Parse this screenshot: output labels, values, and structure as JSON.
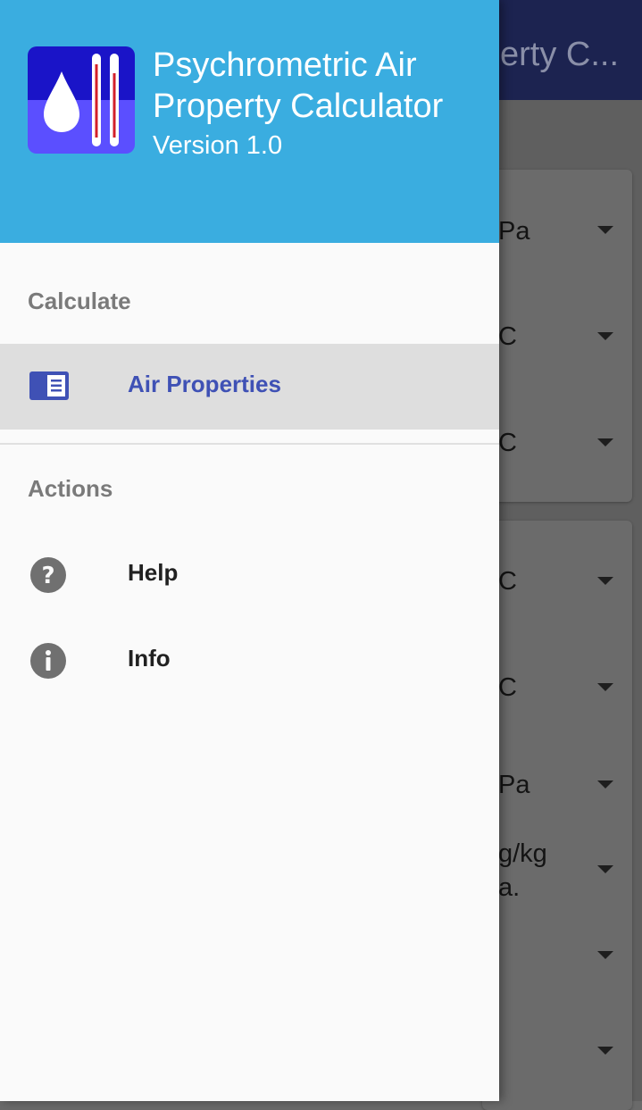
{
  "background": {
    "app_title_partial": "erty C...",
    "rows_card1": [
      "Pa",
      "C",
      "C"
    ],
    "rows_card2": [
      "C",
      "C",
      "Pa",
      "g/kg\na.",
      "",
      ""
    ]
  },
  "drawer": {
    "header": {
      "app_name": "Psychrometric Air Property Calculator",
      "version": "Version 1.0",
      "icon": "droplet-thermometer-icon",
      "color": "#3aade0"
    },
    "sections": [
      {
        "label": "Calculate",
        "items": [
          {
            "label": "Air Properties",
            "icon": "list-panel-icon",
            "active": true
          }
        ]
      },
      {
        "label": "Actions",
        "items": [
          {
            "label": "Help",
            "icon": "help-circle-icon",
            "active": false
          },
          {
            "label": "Info",
            "icon": "info-circle-icon",
            "active": false
          }
        ]
      }
    ],
    "active_color": "#3f51b5"
  }
}
